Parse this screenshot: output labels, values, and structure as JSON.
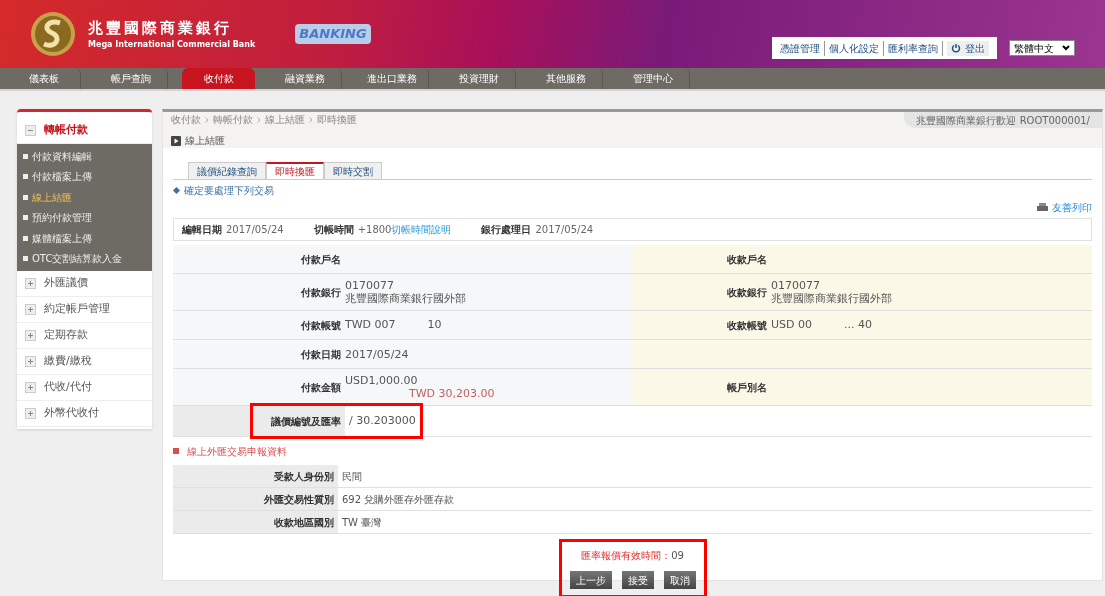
{
  "bank": {
    "name": "兆豐國際商業銀行",
    "name_en": "Mega International Commercial Bank",
    "banking": "BANKING"
  },
  "top_links": [
    "憑證管理",
    "個人化設定",
    "匯利率查詢"
  ],
  "logout": "登出",
  "language": "繁體中文",
  "nav": [
    {
      "label": "儀表板",
      "selected": false
    },
    {
      "label": "帳戶查詢",
      "selected": false
    },
    {
      "label": "收付款",
      "selected": true
    },
    {
      "label": "融資業務",
      "selected": false
    },
    {
      "label": "進出口業務",
      "selected": false
    },
    {
      "label": "投資理財",
      "selected": false
    },
    {
      "label": "其他服務",
      "selected": false
    },
    {
      "label": "管理中心",
      "selected": false
    }
  ],
  "welcome": "兆豐國際商業銀行歡迎 ROOT000001/",
  "sidebar": [
    {
      "label": "轉帳付款",
      "expanded": true,
      "children": [
        {
          "label": "付款資料編輯",
          "selected": false
        },
        {
          "label": "付款檔案上傳",
          "selected": false
        },
        {
          "label": "線上結匯",
          "selected": true
        },
        {
          "label": "預約付款管理",
          "selected": false
        },
        {
          "label": "媒體檔案上傳",
          "selected": false
        },
        {
          "label": "OTC交割結算款入金",
          "selected": false
        }
      ]
    },
    {
      "label": "外匯議價",
      "expanded": false
    },
    {
      "label": "約定帳戶管理",
      "expanded": false
    },
    {
      "label": "定期存款",
      "expanded": false
    },
    {
      "label": "繳費/繳稅",
      "expanded": false
    },
    {
      "label": "代收/代付",
      "expanded": false
    },
    {
      "label": "外幣代收付",
      "expanded": false
    }
  ],
  "breadcrumb": [
    "收付款",
    "轉帳付款",
    "線上結匯",
    "即時換匯"
  ],
  "page_title": "線上結匯",
  "tabs": [
    {
      "label": "議價紀錄查詢",
      "selected": false
    },
    {
      "label": "即時換匯",
      "selected": true
    },
    {
      "label": "即時交割",
      "selected": false
    }
  ],
  "confirm_heading": "確定要處理下列交易",
  "print_link": "友善列印",
  "info_bar": [
    {
      "label": "編輯日期",
      "value": "2017/05/24"
    },
    {
      "label": "切帳時間",
      "value": "+1800",
      "link": "切帳時間說明"
    },
    {
      "label": "銀行處理日",
      "value": "2017/05/24"
    }
  ],
  "detail_rows": [
    {
      "left": {
        "label": "付款戶名"
      },
      "right": {
        "label": "收款戶名"
      }
    },
    {
      "left": {
        "label": "付款銀行",
        "value": [
          "0170077",
          "兆豐國際商業銀行國外部"
        ]
      },
      "right": {
        "label": "收款銀行",
        "value": [
          "0170077",
          "兆豐國際商業銀行國外部"
        ]
      }
    },
    {
      "left": {
        "label": "付款帳號",
        "parts": [
          "TWD 007",
          "10"
        ]
      },
      "right": {
        "label": "收款帳號",
        "parts": [
          "USD 00",
          "... 40"
        ]
      }
    },
    {
      "left": {
        "label": "付款日期",
        "value": [
          "2017/05/24"
        ]
      }
    },
    {
      "left": {
        "label": "付款金額",
        "value": [
          "USD1,000.00"
        ],
        "note": "TWD 30,203.00"
      },
      "right": {
        "label": "帳戶別名"
      }
    }
  ],
  "rate_row": {
    "label": "議價編號及匯率",
    "value": "/ 30.203000",
    "highlighted": true
  },
  "declaration_heading": "線上外匯交易申報資料",
  "declaration_rows": [
    {
      "label": "受款人身份別",
      "value": "民間"
    },
    {
      "label": "外匯交易性質別",
      "value": "692 兌購外匯存外匯存款"
    },
    {
      "label": "收款地區國別",
      "value": "TW 臺灣"
    }
  ],
  "timer": {
    "label": "匯率報價有效時間：",
    "value": "09",
    "highlighted": true
  },
  "buttons": [
    "上一步",
    "接受",
    "取消"
  ]
}
